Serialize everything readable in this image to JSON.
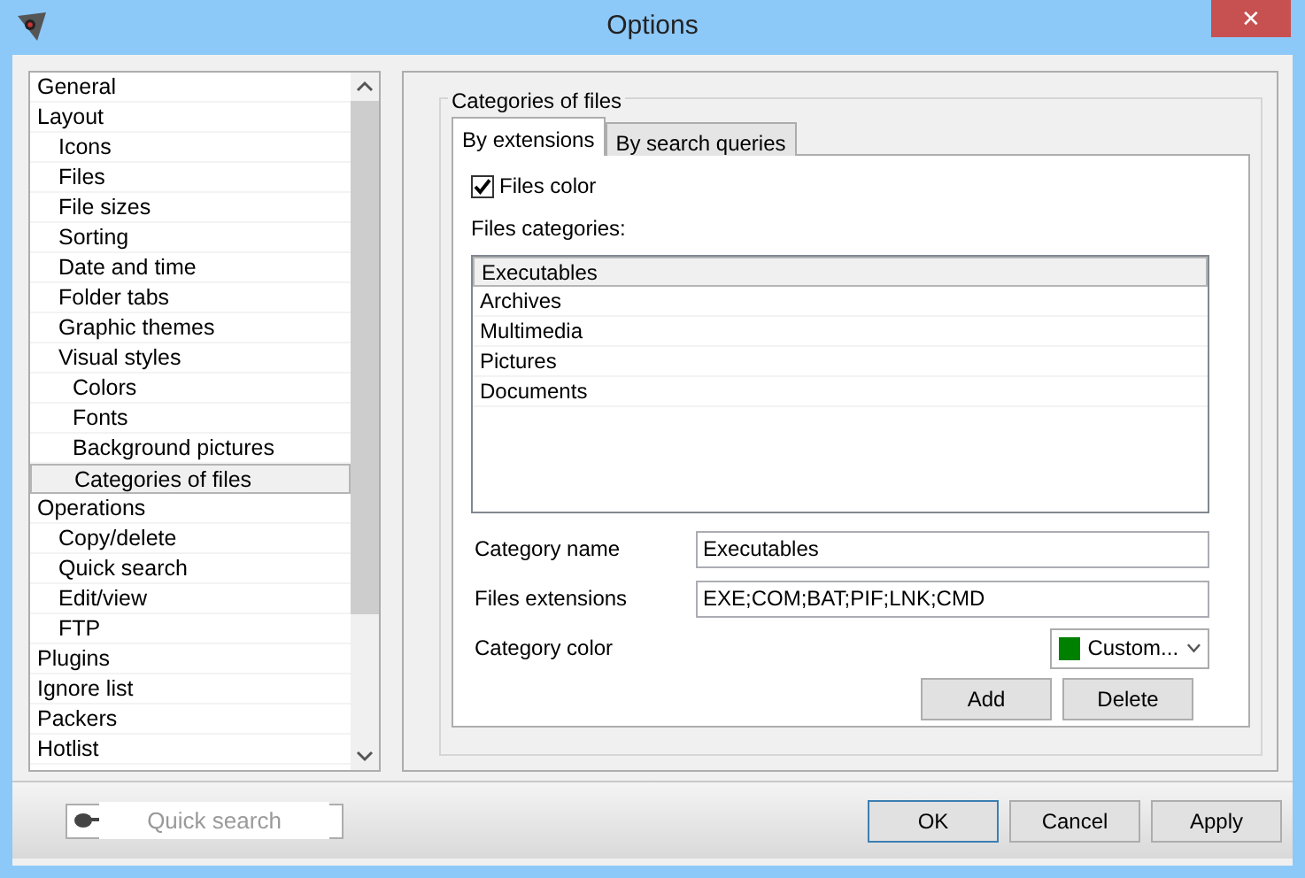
{
  "window": {
    "title": "Options",
    "close": "✕"
  },
  "tree": [
    {
      "label": "General",
      "selected": false
    },
    {
      "label": "Layout",
      "selected": false,
      "children": [
        {
          "label": "Icons",
          "selected": false
        },
        {
          "label": "Files",
          "selected": false
        },
        {
          "label": "File sizes",
          "selected": false
        },
        {
          "label": "Sorting",
          "selected": false
        },
        {
          "label": "Date and time",
          "selected": false
        },
        {
          "label": "Folder tabs",
          "selected": false
        },
        {
          "label": "Graphic themes",
          "selected": false
        },
        {
          "label": "Visual styles",
          "selected": false,
          "children": [
            {
              "label": "Colors",
              "selected": false
            },
            {
              "label": "Fonts",
              "selected": false
            },
            {
              "label": "Background pictures",
              "selected": false
            },
            {
              "label": "Categories of files",
              "selected": true
            }
          ]
        }
      ]
    },
    {
      "label": "Operations",
      "selected": false,
      "children": [
        {
          "label": "Copy/delete",
          "selected": false
        },
        {
          "label": "Quick search",
          "selected": false
        },
        {
          "label": "Edit/view",
          "selected": false
        },
        {
          "label": "FTP",
          "selected": false
        }
      ]
    },
    {
      "label": "Plugins",
      "selected": false
    },
    {
      "label": "Ignore list",
      "selected": false
    },
    {
      "label": "Packers",
      "selected": false
    },
    {
      "label": "Hotlist",
      "selected": false
    }
  ],
  "group": {
    "title": "Categories of files"
  },
  "tabs": [
    {
      "label": "By extensions",
      "selected": true
    },
    {
      "label": "By search queries",
      "selected": false
    }
  ],
  "files_color": {
    "label": "Files color",
    "checked": true
  },
  "categories": {
    "label": "Files categories:",
    "items": [
      {
        "label": "Executables",
        "selected": true
      },
      {
        "label": "Archives",
        "selected": false
      },
      {
        "label": "Multimedia",
        "selected": false
      },
      {
        "label": "Pictures",
        "selected": false
      },
      {
        "label": "Documents",
        "selected": false
      }
    ]
  },
  "fields": [
    {
      "label": "Category name",
      "value": "Executables"
    },
    {
      "label": "Files extensions",
      "value": "EXE;COM;BAT;PIF;LNK;CMD"
    }
  ],
  "category_color": {
    "label": "Category color",
    "value": "Custom...",
    "color": "#008000"
  },
  "list_buttons": [
    "Add",
    "Delete"
  ],
  "quick_search": {
    "placeholder": "Quick search"
  },
  "dialog_buttons": [
    "OK",
    "Cancel",
    "Apply"
  ]
}
